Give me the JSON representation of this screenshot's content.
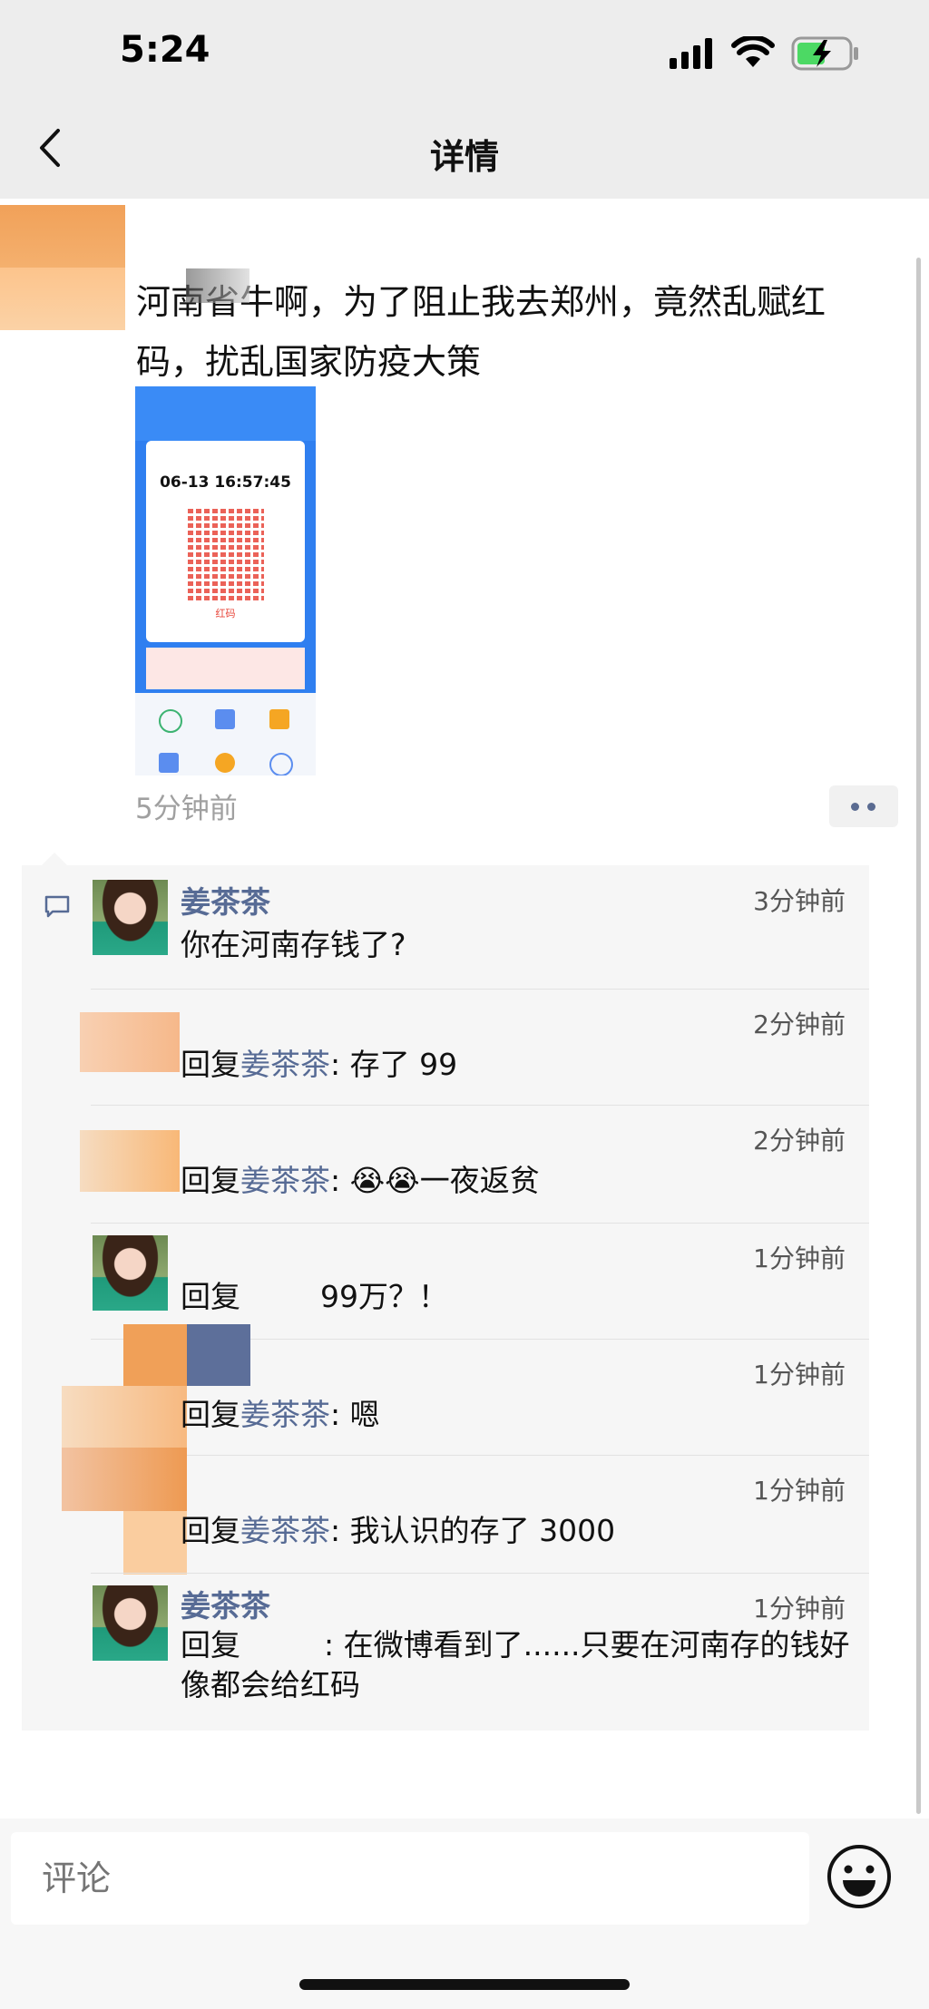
{
  "status_bar": {
    "time": "5:24"
  },
  "nav": {
    "title": "详情"
  },
  "post": {
    "text_line1": "河南省牛啊，为了阻止我去郑州，竟然乱赋红",
    "text_line2": "码，扰乱国家防疫大策",
    "image": {
      "datetime": "06-13 16:57:45",
      "label": "红码"
    },
    "time": "5分钟前"
  },
  "comments": [
    {
      "name": "姜茶茶",
      "time": "3分钟前",
      "text": "你在河南存钱了?"
    },
    {
      "name": "",
      "time": "2分钟前",
      "reply_prefix": "回复",
      "reply_to": "姜茶茶",
      "text": ": 存了 99"
    },
    {
      "name": "",
      "time": "2分钟前",
      "reply_prefix": "回复",
      "reply_to": "姜茶茶",
      "text": ": 😭😭一夜返贫"
    },
    {
      "name": "",
      "time": "1分钟前",
      "reply_prefix": "回复",
      "reply_to": "",
      "text": "99万？！"
    },
    {
      "name": "",
      "time": "1分钟前",
      "reply_prefix": "回复",
      "reply_to": "姜茶茶",
      "text": ": 嗯"
    },
    {
      "name": "",
      "time": "1分钟前",
      "reply_prefix": "回复",
      "reply_to": "姜茶茶",
      "text": ": 我认识的存了 3000"
    },
    {
      "name": "姜茶茶",
      "time": "1分钟前",
      "reply_prefix": "回复",
      "reply_to": "",
      "text": ": 在微博看到了......只要在河南存的钱好像都会给红码"
    }
  ],
  "input": {
    "placeholder": "评论"
  },
  "colors": {
    "link": "#576b95",
    "background": "#ededed",
    "comments_bg": "#f6f6f6"
  },
  "icons": {
    "back": "chevron-left-icon",
    "more": "more-dots-icon",
    "emoji": "smiley-icon",
    "comment": "comment-bubble-icon"
  }
}
